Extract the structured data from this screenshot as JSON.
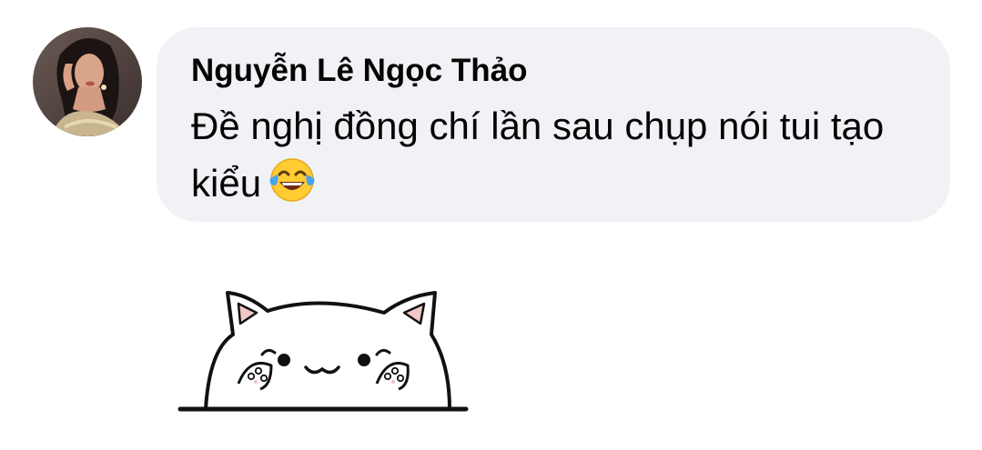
{
  "comment": {
    "author": "Nguyễn Lê Ngọc Thảo",
    "text": "Đề nghị đồng chí lần sau chụp nói tui tạo kiểu",
    "emoji_icon": "face-with-tears-of-joy-icon",
    "avatar_icon": "profile-photo-avatar"
  },
  "sticker": {
    "icon": "peeking-cat-sticker"
  },
  "colors": {
    "bubble_background": "#f0f2f5",
    "text": "#050505",
    "emoji_yellow": "#ffcc33",
    "tear_blue": "#4aa3ef"
  }
}
